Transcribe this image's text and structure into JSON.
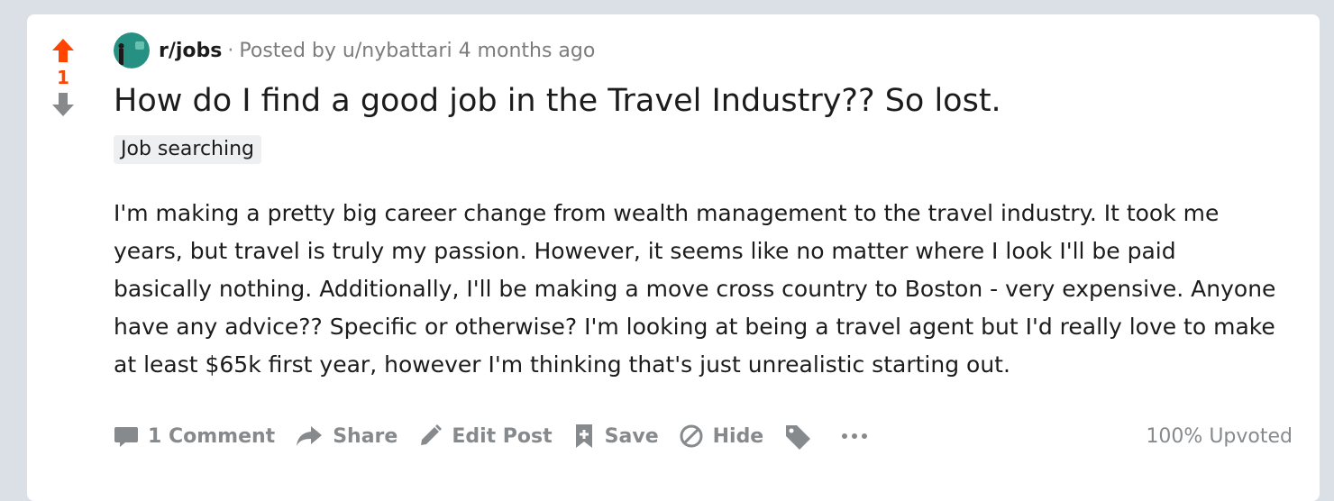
{
  "post": {
    "score": "1",
    "subreddit": "r/jobs",
    "separator": "·",
    "posted_by_prefix": "Posted by",
    "username": "u/nybattari",
    "age": "4 months ago",
    "title": "How do I find a good job in the Travel Industry?? So lost.",
    "flair": "Job searching",
    "body": [
      "I'm making a pretty big career change from wealth management to the travel industry. It took me years, but travel is truly my passion. However, it seems like no matter where I look I'll be paid basically nothing. Additionally, I'll be making a move cross country to Boston - very expensive. Anyone have any advice?? Specific or otherwise? I'm looking at being a travel agent but I'd really love to make at least $65k first year, however I'm thinking that's just unrealistic starting out."
    ],
    "upvote_ratio": "100% Upvoted"
  },
  "actions": {
    "comments": "1 Comment",
    "share": "Share",
    "edit": "Edit Post",
    "save": "Save",
    "hide": "Hide"
  },
  "icons": {
    "upvote": "arrow-up-icon",
    "downvote": "arrow-down-icon",
    "comment": "comment-icon",
    "share": "share-icon",
    "edit": "pencil-icon",
    "save": "bookmark-icon",
    "hide": "hide-icon",
    "tag": "tag-icon",
    "more": "more-dots-icon"
  },
  "colors": {
    "upvote_active": "#ff4500",
    "vote_neutral": "#878a8c",
    "page_background": "#dae0e6",
    "card_background": "#ffffff",
    "flair_background": "#edeff1"
  }
}
